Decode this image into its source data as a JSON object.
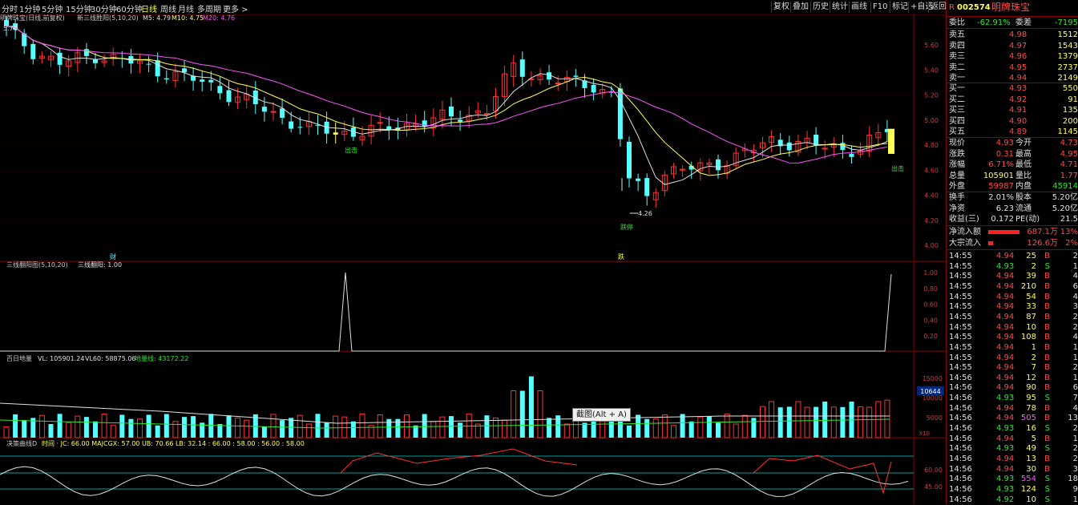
{
  "toolbar": {
    "periods": [
      "分时",
      "1分钟",
      "5分钟",
      "15分钟",
      "30分钟",
      "60分钟",
      "日线",
      "周线",
      "月线",
      "多周期",
      "更多 >"
    ],
    "active_period": "日线",
    "buttons": [
      "复权",
      "叠加",
      "历史",
      "统计",
      "画线",
      "F10",
      "标记",
      "+自选",
      "返回"
    ]
  },
  "main_chart": {
    "title": "明牌珠宝(日线,前复权)",
    "indicator_name": "新三线胜阳(5,10,20)",
    "ma5": "M5: 4.79",
    "ma10": "M10: 4.75",
    "ma20": "M20: 4.76",
    "price_ticks": [
      "5.60",
      "5.40",
      "5.20",
      "5.00",
      "4.80",
      "4.60",
      "4.40",
      "4.20",
      "4.00"
    ],
    "high_label": "5.76",
    "low_label": "4.26",
    "signal_out1": "出击",
    "signal_out2": "出击",
    "signal_stop": "跌停",
    "mark_cai": "财",
    "mark_jie": "跌"
  },
  "sub1": {
    "title": "三线翻阳图(5,10,20)",
    "value": "三线翻阳: 1.00",
    "ticks": [
      "1.00",
      "0.80",
      "0.60",
      "0.40",
      "0.20"
    ]
  },
  "sub2": {
    "title": "百日地量",
    "vol": "VL: 105901.24",
    "vl60": "VL60: 58875.06",
    "floor": "地量线: 43172.22",
    "ticks": [
      "15000",
      "10000",
      "5000"
    ],
    "cur_vol_tag": "10644",
    "unit": "X10"
  },
  "sub3": {
    "title": "决策曲线D",
    "params": "时间 · JC: 66.00  MAJCGX: 57.00  UB: 70.66  LB: 32.14  : 66.00  : 58.00  : 56.00  : 58.00",
    "ticks": [
      "60.00",
      "45.00"
    ]
  },
  "tooltip": "截图(Alt + A)",
  "stock": {
    "code": "002574",
    "name": "明牌珠宝",
    "flag": "R"
  },
  "order_book": {
    "weibi_label": "委比",
    "weibi": "-62.91%",
    "weicha_label": "委差",
    "weicha": "-7195",
    "asks": [
      {
        "label": "卖五",
        "price": "4.98",
        "vol": "1512"
      },
      {
        "label": "卖四",
        "price": "4.97",
        "vol": "1543"
      },
      {
        "label": "卖三",
        "price": "4.96",
        "vol": "1379"
      },
      {
        "label": "卖二",
        "price": "4.95",
        "vol": "2737"
      },
      {
        "label": "卖一",
        "price": "4.94",
        "vol": "2149"
      }
    ],
    "bids": [
      {
        "label": "买一",
        "price": "4.93",
        "vol": "550"
      },
      {
        "label": "买二",
        "price": "4.92",
        "vol": "91"
      },
      {
        "label": "买三",
        "price": "4.91",
        "vol": "135"
      },
      {
        "label": "买四",
        "price": "4.90",
        "vol": "200"
      },
      {
        "label": "买五",
        "price": "4.89",
        "vol": "1145"
      }
    ]
  },
  "quote": [
    {
      "l1": "现价",
      "v1": "4.93",
      "c1": "red",
      "l2": "今开",
      "v2": "4.73",
      "c2": "red"
    },
    {
      "l1": "涨跌",
      "v1": "0.31",
      "c1": "red",
      "l2": "最高",
      "v2": "4.95",
      "c2": "red"
    },
    {
      "l1": "涨幅",
      "v1": "6.71%",
      "c1": "red",
      "l2": "最低",
      "v2": "4.71",
      "c2": "red"
    },
    {
      "l1": "总量",
      "v1": "105901",
      "c1": "yel",
      "l2": "量比",
      "v2": "1.77",
      "c2": "red"
    },
    {
      "l1": "外盘",
      "v1": "59987",
      "c1": "red",
      "l2": "内盘",
      "v2": "45914",
      "c2": "grn"
    }
  ],
  "stats": [
    {
      "l1": "换手",
      "v1": "2.01%",
      "l2": "股本",
      "v2": "5.20亿"
    },
    {
      "l1": "净资",
      "v1": "6.23",
      "l2": "流通",
      "v2": "5.20亿"
    },
    {
      "l1": "收益(三)",
      "v1": "0.172",
      "l2": "PE(动)",
      "v2": "21.5"
    }
  ],
  "flow": [
    {
      "label": "净流入额",
      "value": "687.1万",
      "pct": "13%",
      "bar": 0.55
    },
    {
      "label": "大宗流入",
      "value": "126.6万",
      "pct": "2%",
      "bar": 0.08
    }
  ],
  "ticks": [
    {
      "t": "14:55",
      "p": "4.94",
      "v": "25",
      "s": "B",
      "n": "2"
    },
    {
      "t": "14:55",
      "p": "4.93",
      "v": "2",
      "s": "S",
      "n": "1"
    },
    {
      "t": "14:55",
      "p": "4.94",
      "v": "39",
      "s": "B",
      "n": "4"
    },
    {
      "t": "14:55",
      "p": "4.94",
      "v": "210",
      "s": "B",
      "n": "6"
    },
    {
      "t": "14:55",
      "p": "4.94",
      "v": "54",
      "s": "B",
      "n": "4"
    },
    {
      "t": "14:55",
      "p": "4.94",
      "v": "33",
      "s": "B",
      "n": "3"
    },
    {
      "t": "14:55",
      "p": "4.94",
      "v": "87",
      "s": "B",
      "n": "2"
    },
    {
      "t": "14:55",
      "p": "4.94",
      "v": "10",
      "s": "B",
      "n": "2"
    },
    {
      "t": "14:55",
      "p": "4.94",
      "v": "108",
      "s": "B",
      "n": "4"
    },
    {
      "t": "14:55",
      "p": "4.94",
      "v": "1",
      "s": "B",
      "n": "1"
    },
    {
      "t": "14:55",
      "p": "4.94",
      "v": "2",
      "s": "B",
      "n": "1"
    },
    {
      "t": "14:55",
      "p": "4.94",
      "v": "7",
      "s": "B",
      "n": "2"
    },
    {
      "t": "14:56",
      "p": "4.94",
      "v": "12",
      "s": "B",
      "n": "1"
    },
    {
      "t": "14:56",
      "p": "4.94",
      "v": "90",
      "s": "B",
      "n": "6"
    },
    {
      "t": "14:56",
      "p": "4.93",
      "v": "95",
      "s": "S",
      "n": "7"
    },
    {
      "t": "14:56",
      "p": "4.94",
      "v": "78",
      "s": "B",
      "n": "4"
    },
    {
      "t": "14:56",
      "p": "4.94",
      "v": "505",
      "s": "B",
      "n": "13"
    },
    {
      "t": "14:56",
      "p": "4.93",
      "v": "16",
      "s": "S",
      "n": "2"
    },
    {
      "t": "14:56",
      "p": "4.94",
      "v": "5",
      "s": "B",
      "n": "1"
    },
    {
      "t": "14:56",
      "p": "4.93",
      "v": "49",
      "s": "S",
      "n": "2"
    },
    {
      "t": "14:56",
      "p": "4.94",
      "v": "13",
      "s": "B",
      "n": "2"
    },
    {
      "t": "14:56",
      "p": "4.94",
      "v": "30",
      "s": "B",
      "n": "3"
    },
    {
      "t": "14:56",
      "p": "4.93",
      "v": "554",
      "s": "S",
      "n": "18"
    },
    {
      "t": "14:56",
      "p": "4.93",
      "v": "124",
      "s": "S",
      "n": "9"
    },
    {
      "t": "14:56",
      "p": "4.92",
      "v": "10",
      "s": "S",
      "n": "1"
    }
  ]
}
